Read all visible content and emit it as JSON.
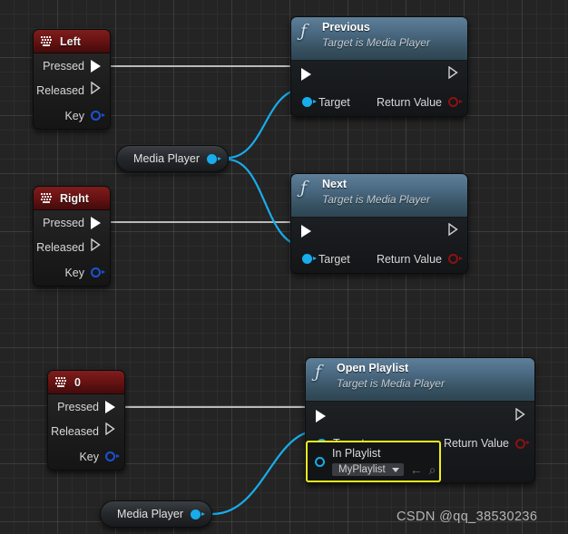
{
  "graph": {
    "watermark": "CSDN @qq_38530236",
    "accent_colors": {
      "event_header": "#6a1313",
      "function_header": "#4b6a83",
      "exec_wire": "#b9b9b9",
      "object_wire": "#19acec",
      "object_pin": "#19acec",
      "key_pin": "#1b52d8",
      "return_pin": "#8c1212",
      "highlight_box": "#f2ee1d",
      "canvas_background": "#242424"
    },
    "nodes": [
      {
        "id": "event-left",
        "kind": "event",
        "icon": "keyboard-icon",
        "title": "Left",
        "pins": [
          {
            "name": "Pressed",
            "type": "exec-out-filled"
          },
          {
            "name": "Released",
            "type": "exec-out-hollow"
          },
          {
            "name": "Key",
            "type": "ring-blue"
          }
        ]
      },
      {
        "id": "event-right",
        "kind": "event",
        "icon": "keyboard-icon",
        "title": "Right",
        "pins": [
          {
            "name": "Pressed",
            "type": "exec-out-filled"
          },
          {
            "name": "Released",
            "type": "exec-out-hollow"
          },
          {
            "name": "Key",
            "type": "ring-blue"
          }
        ]
      },
      {
        "id": "event-zero",
        "kind": "event",
        "icon": "keyboard-icon",
        "title": "0",
        "pins": [
          {
            "name": "Pressed",
            "type": "exec-out-filled"
          },
          {
            "name": "Released",
            "type": "exec-out-hollow"
          },
          {
            "name": "Key",
            "type": "ring-blue"
          }
        ]
      },
      {
        "id": "func-previous",
        "kind": "function",
        "icon": "function-icon",
        "title": "Previous",
        "subtitle": "Target is Media Player",
        "inputs": [
          "Target"
        ],
        "outputs": [
          "Return Value"
        ]
      },
      {
        "id": "func-next",
        "kind": "function",
        "icon": "function-icon",
        "title": "Next",
        "subtitle": "Target is Media Player",
        "inputs": [
          "Target"
        ],
        "outputs": [
          "Return Value"
        ]
      },
      {
        "id": "func-open-playlist",
        "kind": "function",
        "icon": "function-icon",
        "title": "Open Playlist",
        "subtitle": "Target is Media Player",
        "inputs": [
          "Target",
          "In Playlist"
        ],
        "outputs": [
          "Return Value"
        ]
      },
      {
        "id": "var-media-player-top",
        "kind": "variable",
        "title": "Media Player"
      },
      {
        "id": "var-media-player-bottom",
        "kind": "variable",
        "title": "Media Player"
      }
    ],
    "in_playlist_widget": {
      "label": "In Playlist",
      "selected_value": "MyPlaylist",
      "use_selected_icon": "left-arrow-icon",
      "browse_icon": "magnifier-icon"
    }
  },
  "labels": {
    "left_title": "Left",
    "right_title": "Right",
    "zero_title": "0",
    "pressed": "Pressed",
    "released": "Released",
    "key": "Key",
    "target": "Target",
    "return_value": "Return Value",
    "media_player": "Media Player",
    "previous_title": "Previous",
    "next_title": "Next",
    "open_playlist_title": "Open Playlist",
    "target_is_media_player": "Target is Media Player",
    "f_glyph": "ƒ",
    "in_playlist": "In Playlist",
    "my_playlist": "MyPlaylist",
    "use_selected": "←",
    "browse": "⌕"
  }
}
